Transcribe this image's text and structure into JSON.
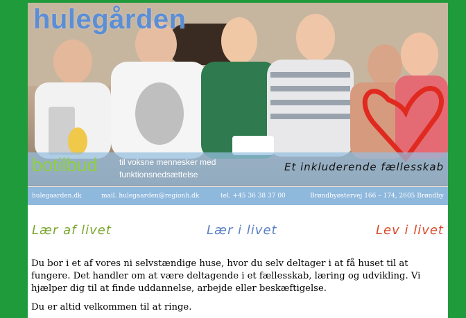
{
  "header": {
    "site_title": "hulegården",
    "subtitle": "botilbud",
    "tagline": "til voksne mennesker med funktionsnedsættelse",
    "slogan": "Et inkluderende fællesskab"
  },
  "contact": {
    "website": "hulegaarden.dk",
    "email": "mail.  hulegaarden@regionh.dk",
    "phone": "tel.  +45 36 38 37 00",
    "address": "Brøndbyøstervej 166 – 174, 2605 Brøndby"
  },
  "mottos": [
    "Lær af livet",
    "Lær i livet",
    "Lev i livet"
  ],
  "content": {
    "intro": "Du bor i et af vores ni selvstændige huse, hvor du selv deltager i at få huset til at fungere. Det handler om at være deltagende i et fællesskab, læring og udvikling. Vi hjælper dig til at finde uddannelse, arbejde eller beskæftigelse.",
    "welcome": "Du er altid velkommen til at ringe."
  },
  "colors": {
    "frame": "#1f9b3c",
    "title_blue": "#5b8ed6",
    "botilbud_green": "#8ed13c",
    "band_blue": "#8fb8dd",
    "heart_red": "#e02a20"
  }
}
